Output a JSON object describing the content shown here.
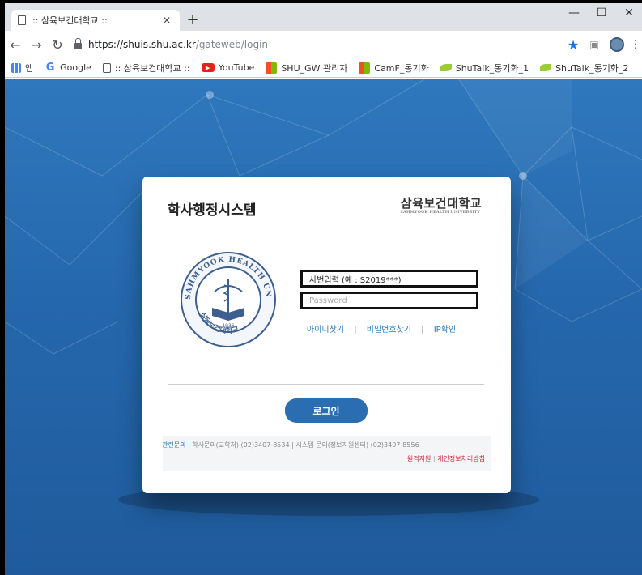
{
  "browser": {
    "tab_title": ":: 삼육보건대학교 ::",
    "tab_close": "×",
    "new_tab": "+",
    "window_controls": {
      "minimize": "—",
      "maximize": "☐",
      "close": "✕"
    },
    "url_host": "https://shuis.shu.ac.kr",
    "url_path": "/gateweb/login",
    "bookmarks": [
      {
        "label": "앱",
        "icon": "apps-icon"
      },
      {
        "label": "Google",
        "icon": "google-icon"
      },
      {
        "label": ":: 삼육보건대학교 ::",
        "icon": "document-icon"
      },
      {
        "label": "YouTube",
        "icon": "youtube-icon"
      },
      {
        "label": "SHU_GW 관리자",
        "icon": "site-icon"
      },
      {
        "label": "CamF_동기화",
        "icon": "site-icon"
      },
      {
        "label": "ShuTalk_동기화_1",
        "icon": "leaf-icon"
      },
      {
        "label": "ShuTalk_동기화_2",
        "icon": "leaf-icon"
      }
    ]
  },
  "login": {
    "system_title": "학사행정시스템",
    "university_name": "삼육보건대학교",
    "university_name_en": "SAHMYOOK HEALTH UNIVERSITY",
    "seal_text": "SAHMYOOK HEALTH UNIVERSITY",
    "seal_korean": "삼육보건대학교",
    "seal_year": "1936",
    "id_value": "사번입력 (예 : S2019***)",
    "password_placeholder": "Password",
    "link_find_id": "아이디찾기",
    "link_find_pw": "비밀번호찾기",
    "link_ip": "IP확인",
    "link_sep": "|",
    "login_button": "로그인",
    "contact_label": "관련문의",
    "contact_text": " : 학사문의(교학처) (02)3407-8534 | 시스템 문의(정보지원센터) (02)3407-8556",
    "remote_support": "원격지원",
    "privacy_policy": "개인정보처리방침",
    "footer_sep": " | "
  },
  "colors": {
    "page_bg": "#2567ac",
    "login_button": "#2a6db0",
    "link": "#2a7ab8",
    "accent_red": "#d0213b"
  }
}
